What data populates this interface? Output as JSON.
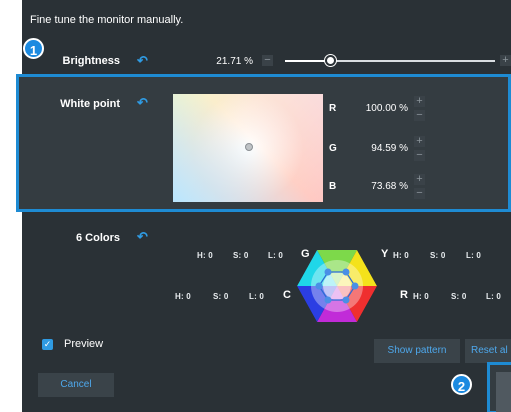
{
  "intro": "Fine tune the monitor manually.",
  "brightness": {
    "label": "Brightness",
    "value": "21.71 %",
    "level_percent": 21.71
  },
  "white_point": {
    "label": "White point",
    "channels": [
      {
        "letter": "R",
        "value": "100.00 %"
      },
      {
        "letter": "G",
        "value": "94.59 %"
      },
      {
        "letter": "B",
        "value": "73.68 %"
      }
    ]
  },
  "six_colors": {
    "label": "6 Colors",
    "rows": [
      {
        "left_hsl": [
          "H: 0",
          "S: 0",
          "L: 0"
        ],
        "left_letter": "G",
        "right_letter": "Y",
        "right_hsl": [
          "H: 0",
          "S: 0",
          "L: 0"
        ]
      },
      {
        "left_hsl": [
          "H: 0",
          "S: 0",
          "L: 0"
        ],
        "left_letter": "C",
        "right_letter": "R",
        "right_hsl": [
          "H: 0",
          "S: 0",
          "L: 0"
        ]
      }
    ]
  },
  "preview": {
    "label": "Preview",
    "checked": true
  },
  "buttons": {
    "show_pattern": "Show pattern",
    "reset_all": "Reset al",
    "cancel": "Cancel"
  },
  "badges": {
    "one": "1",
    "two": "2"
  },
  "icons": {
    "undo": "undo-arrow-icon",
    "check": "checkmark-icon"
  },
  "colors": {
    "accent": "#1e8bd3",
    "panel": "#2a3136"
  }
}
